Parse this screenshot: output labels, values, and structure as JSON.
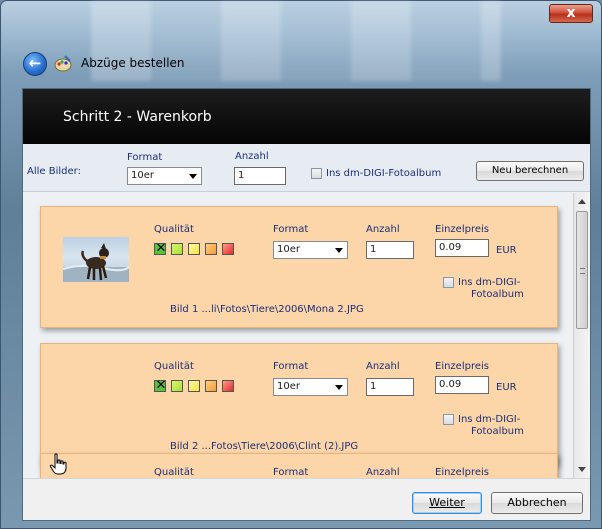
{
  "window": {
    "title": "Abzüge bestellen",
    "close_label": "x"
  },
  "header": {
    "step_title": "Schritt 2 - Warenkorb"
  },
  "all_images": {
    "label": "Alle Bilder:",
    "format_label": "Format",
    "format_value": "10er",
    "count_label": "Anzahl",
    "count_value": "1",
    "album_label": "Ins dm-DIGI-Fotoalbum",
    "recalc_button": "Neu berechnen"
  },
  "columns": {
    "quality": "Qualität",
    "format": "Format",
    "count": "Anzahl",
    "unit_price": "Einzelpreis"
  },
  "items": [
    {
      "format": "10er",
      "count": "1",
      "price": "0.09",
      "currency": "EUR",
      "album_line1": "Ins dm-DIGI-",
      "album_line2": "Fotoalbum",
      "filename": "Bild 1 ...li\\Fotos\\Tiere\\2006\\Mona 2.JPG",
      "has_thumbnail": true
    },
    {
      "format": "10er",
      "count": "1",
      "price": "0.09",
      "currency": "EUR",
      "album_line1": "Ins dm-DIGI-",
      "album_line2": "Fotoalbum",
      "filename": "Bild 2 ...Fotos\\Tiere\\2006\\Clint (2).JPG",
      "has_thumbnail": false
    },
    {
      "partial": true
    }
  ],
  "footer": {
    "next_button": "Weiter",
    "cancel_button": "Abbrechen"
  },
  "colors": {
    "card_bg": "#fcd5a8",
    "header_bg": "#0a0a0a",
    "label_blue": "#1a2f7a"
  },
  "icons": {
    "back": "back-arrow-icon",
    "app": "paint-palette-icon",
    "cursor": "hand-pointer-icon"
  }
}
